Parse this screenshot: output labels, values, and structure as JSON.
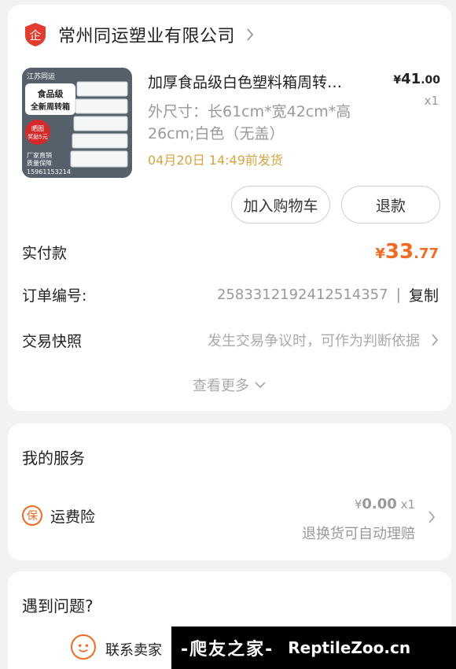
{
  "shop": {
    "name": "常州同运塑业有限公司",
    "logo_icon": "shop-badge-icon"
  },
  "product": {
    "title": "加厚食品级白色塑料箱周转…",
    "price_currency": "¥",
    "price_int": "41",
    "price_dec": ".00",
    "quantity": "x1",
    "spec_line1": "外尺寸：长61cm*宽42cm*高",
    "spec_line2": "26cm;白色（无盖）",
    "ship_time": "04月20日 14:49前发货",
    "thumb": {
      "brand": "江苏同运",
      "headline1": "食品级",
      "headline2": "全新周转箱",
      "badge1": "晒图",
      "badge2": "奖励5元",
      "footer1": "厂家直销",
      "footer2": "质量保障",
      "phone": "15961153214"
    }
  },
  "actions": {
    "add_to_cart": "加入购物车",
    "refund": "退款"
  },
  "payment": {
    "label": "实付款",
    "currency": "¥",
    "amount_int": "33",
    "amount_dec": ".77"
  },
  "order": {
    "label": "订单编号:",
    "number": "2583312192412514357",
    "copy": "复制"
  },
  "snapshot": {
    "label": "交易快照",
    "hint": "发生交易争议时，可作为判断依据"
  },
  "view_more": "查看更多",
  "services": {
    "title": "我的服务",
    "item": {
      "icon_char": "保",
      "name": "运费险",
      "currency": "¥",
      "price": "0.00",
      "quantity": "x1",
      "desc": "退换货可自动理赔"
    }
  },
  "issues": {
    "title": "遇到问题?",
    "contact": "联系卖家"
  },
  "watermark": {
    "left": "-爬友之家-",
    "right": "ReptileZoo.cn"
  },
  "colors": {
    "accent": "#f26b21",
    "ship": "#d9a441",
    "logo": "#e33b2e"
  }
}
